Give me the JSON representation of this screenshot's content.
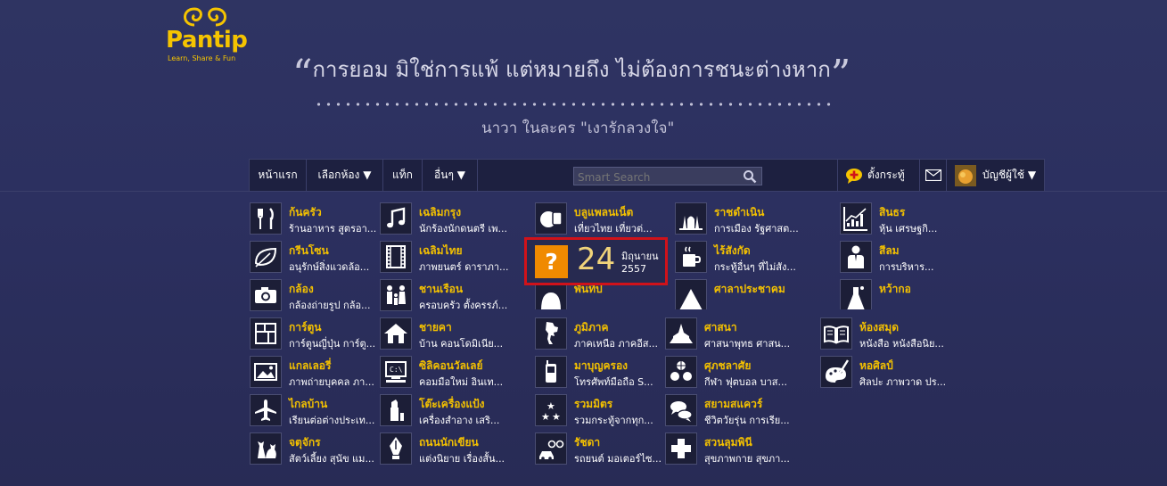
{
  "brand": {
    "logo_text": "Pantip",
    "tagline": "Learn, Share & Fun",
    "color": "#f5c400"
  },
  "quote": {
    "open_mark": "“",
    "text": "การยอม มิใช่การแพ้ แต่หมายถึง ไม่ต้องการชนะต่างหาก",
    "close_mark": "”",
    "attribution": "นาวา ในละคร \"เงารักลวงใจ\""
  },
  "nav": {
    "home": "หน้าแรก",
    "choose_room": "เลือกห้อง ▼",
    "tags": "แท็ก",
    "others": "อื่นๆ ▼",
    "search_placeholder": "Smart Search",
    "post_topic": "ตั้งกระทู้",
    "account": "บัญชีผู้ใช้ ▼"
  },
  "rooms": [
    {
      "name": "ก้นครัว",
      "desc": "ร้านอาหาร สูตรอา...",
      "icon": "fork-knife-icon"
    },
    {
      "name": "กรีนโซน",
      "desc": "อนุรักษ์สิ่งแวดล้อ...",
      "icon": "leaf-icon"
    },
    {
      "name": "กล้อง",
      "desc": "กล้องถ่ายรูป กล้อ...",
      "icon": "camera-icon"
    },
    {
      "name": "การ์ตูน",
      "desc": "การ์ตูนญี่ปุ่น การ์ตู...",
      "icon": "comic-icon"
    },
    {
      "name": "แกลเลอรี่",
      "desc": "ภาพถ่ายบุคคล ภา...",
      "icon": "picture-icon"
    },
    {
      "name": "ไกลบ้าน",
      "desc": "เรียนต่อต่างประเท...",
      "icon": "airplane-icon"
    },
    {
      "name": "จตุจักร",
      "desc": "สัตว์เลี้ยง สุนัข แม...",
      "icon": "pets-icon"
    },
    {
      "name": "เฉลิมกรุง",
      "desc": "นักร้องนักดนตรี เพ...",
      "icon": "music-note-icon"
    },
    {
      "name": "เฉลิมไทย",
      "desc": "ภาพยนตร์ ดาราภา...",
      "icon": "film-icon"
    },
    {
      "name": "ชานเรือน",
      "desc": "ครอบครัว ตั้งครรภ์...",
      "icon": "family-icon"
    },
    {
      "name": "ชายคา",
      "desc": "บ้าน คอนโดมิเนีย...",
      "icon": "house-icon"
    },
    {
      "name": "ซิลิคอนวัลเลย์",
      "desc": "คอมมือใหม่ อินเท...",
      "icon": "computer-icon"
    },
    {
      "name": "โต๊ะเครื่องแป้ง",
      "desc": "เครื่องสำอาง เสริ...",
      "icon": "cosmetics-icon"
    },
    {
      "name": "ถนนนักเขียน",
      "desc": "แต่งนิยาย เรื่องสั้น...",
      "icon": "fountain-pen-icon"
    },
    {
      "name": "บลูแพลนเน็ต",
      "desc": "เที่ยวไทย เที่ยวต่...",
      "icon": "travel-icon"
    },
    {
      "name": "พันทิป",
      "desc": "",
      "icon": "pantip-icon"
    },
    {
      "name": "ภูมิภาค",
      "desc": "ภาคเหนือ ภาคอีส...",
      "icon": "thailand-map-icon"
    },
    {
      "name": "มาบุญครอง",
      "desc": "โทรศัพท์มือถือ S...",
      "icon": "mobile-phone-icon"
    },
    {
      "name": "รวมมิตร",
      "desc": "รวมกระทู้จากทุก...",
      "icon": "stars-icon"
    },
    {
      "name": "รัชดา",
      "desc": "รถยนต์ มอเตอร์ไซ...",
      "icon": "car-bike-icon"
    },
    {
      "name": "ราชดำเนิน",
      "desc": "การเมือง รัฐศาสต...",
      "icon": "democracy-monument-icon"
    },
    {
      "name": "ไร้สังกัด",
      "desc": "กระทู้อื่นๆ ที่ไม่สัง...",
      "icon": "coffee-cup-icon"
    },
    {
      "name": "ศาลาประชาคม",
      "desc": "",
      "icon": "pavilion-icon"
    },
    {
      "name": "ศาสนา",
      "desc": "ศาสนาพุทธ ศาสน...",
      "icon": "temple-icon"
    },
    {
      "name": "ศุภชลาศัย",
      "desc": "กีฬา ฟุตบอล บาส...",
      "icon": "sports-balls-icon"
    },
    {
      "name": "สยามสแควร์",
      "desc": "ชีวิตวัยรุ่น การเรีย...",
      "icon": "speech-bubbles-icon"
    },
    {
      "name": "สวนลุมพินี",
      "desc": "สุขภาพกาย สุขภา...",
      "icon": "medical-cross-icon"
    },
    {
      "name": "สินธร",
      "desc": "หุ้น เศรษฐกิ...",
      "icon": "stock-chart-icon"
    },
    {
      "name": "สีลม",
      "desc": "การบริหาร...",
      "icon": "business-man-icon"
    },
    {
      "name": "หว้ากอ",
      "desc": "",
      "icon": "science-icon"
    },
    {
      "name": "ห้องสมุด",
      "desc": "หนังสือ หนังสือนิย...",
      "icon": "open-book-icon"
    },
    {
      "name": "หอศิลป์",
      "desc": "ศิลปะ ภาพวาด ปร...",
      "icon": "palette-icon"
    }
  ],
  "calendar_popup": {
    "icon_symbol": "?",
    "day": "24",
    "month": "มิถุนายน",
    "year": "2557",
    "highlight_color": "#d0121a"
  },
  "colors": {
    "room_name": "#f3c000",
    "background": "#2d3160"
  }
}
